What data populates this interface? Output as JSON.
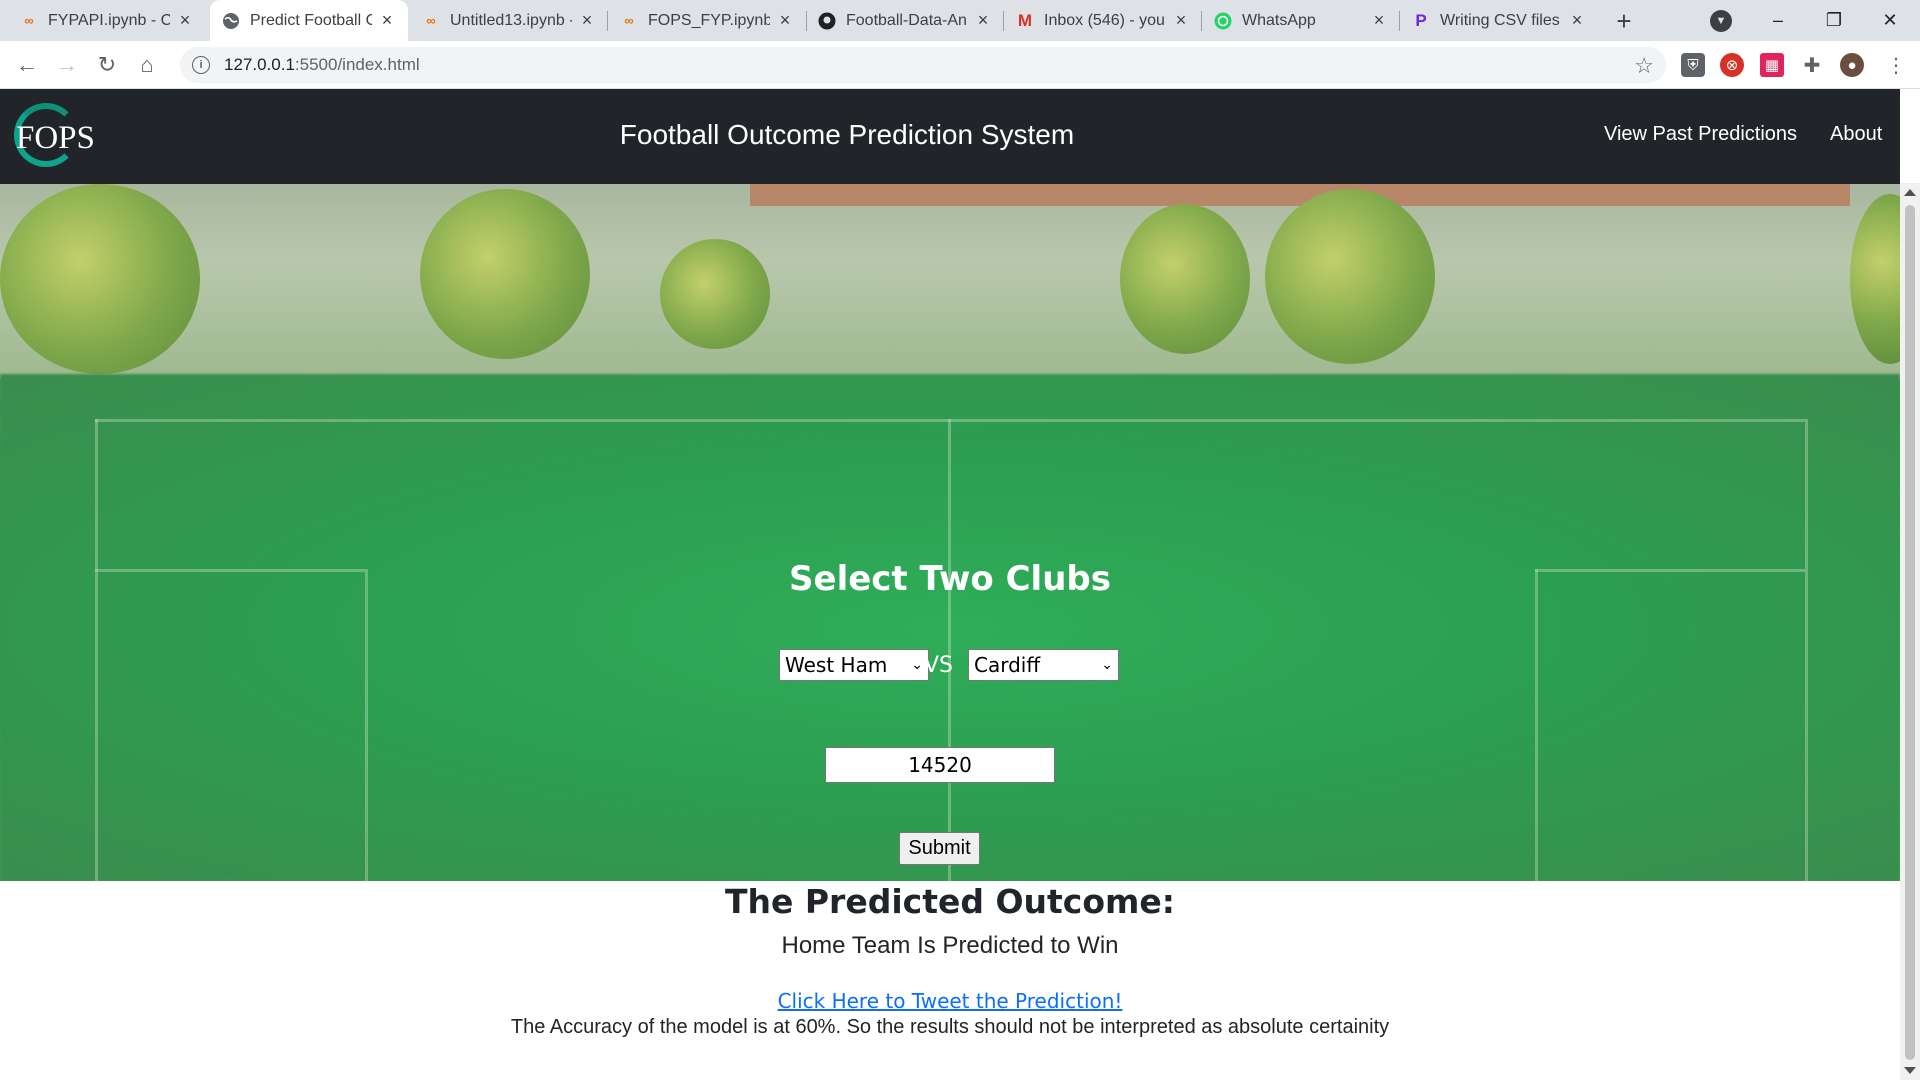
{
  "browser": {
    "tabs": [
      {
        "title": "FYPAPI.ipynb - Co",
        "icon": "colab-icon"
      },
      {
        "title": "Predict Football O",
        "icon": "globe-icon",
        "active": true
      },
      {
        "title": "Untitled13.ipynb -",
        "icon": "colab-icon"
      },
      {
        "title": "FOPS_FYP.ipynb -",
        "icon": "colab-icon"
      },
      {
        "title": "Football-Data-An",
        "icon": "github-icon"
      },
      {
        "title": "Inbox (546) - you",
        "icon": "gmail-icon"
      },
      {
        "title": "WhatsApp",
        "icon": "whatsapp-icon"
      },
      {
        "title": "Writing CSV files",
        "icon": "p-icon"
      }
    ],
    "new_tab": "+",
    "url_host": "127.0.0.1",
    "url_rest": ":5500/index.html",
    "window_controls": [
      "–",
      "❐",
      "✕"
    ]
  },
  "site": {
    "logo_text": "FOPS",
    "title": "Football Outcome Prediction System",
    "nav": [
      "View Past Predictions",
      "About"
    ]
  },
  "form": {
    "title": "Select Two Clubs",
    "home_club": "West Ham",
    "away_club": "Cardiff",
    "vs_label": "VS",
    "match_value": "14520",
    "submit_label": "Submit"
  },
  "result": {
    "heading": "The Predicted Outcome:",
    "text": "Home Team Is Predicted to Win",
    "tweet_link": "Click Here to Tweet the Prediction!",
    "accuracy_note": "The Accuracy of the model is at 60%. So the results should not be interpreted as absolute certainity"
  },
  "colors": {
    "header_bg": "#212529",
    "logo_accent": "#0fa38d",
    "link": "#0d6efd"
  }
}
